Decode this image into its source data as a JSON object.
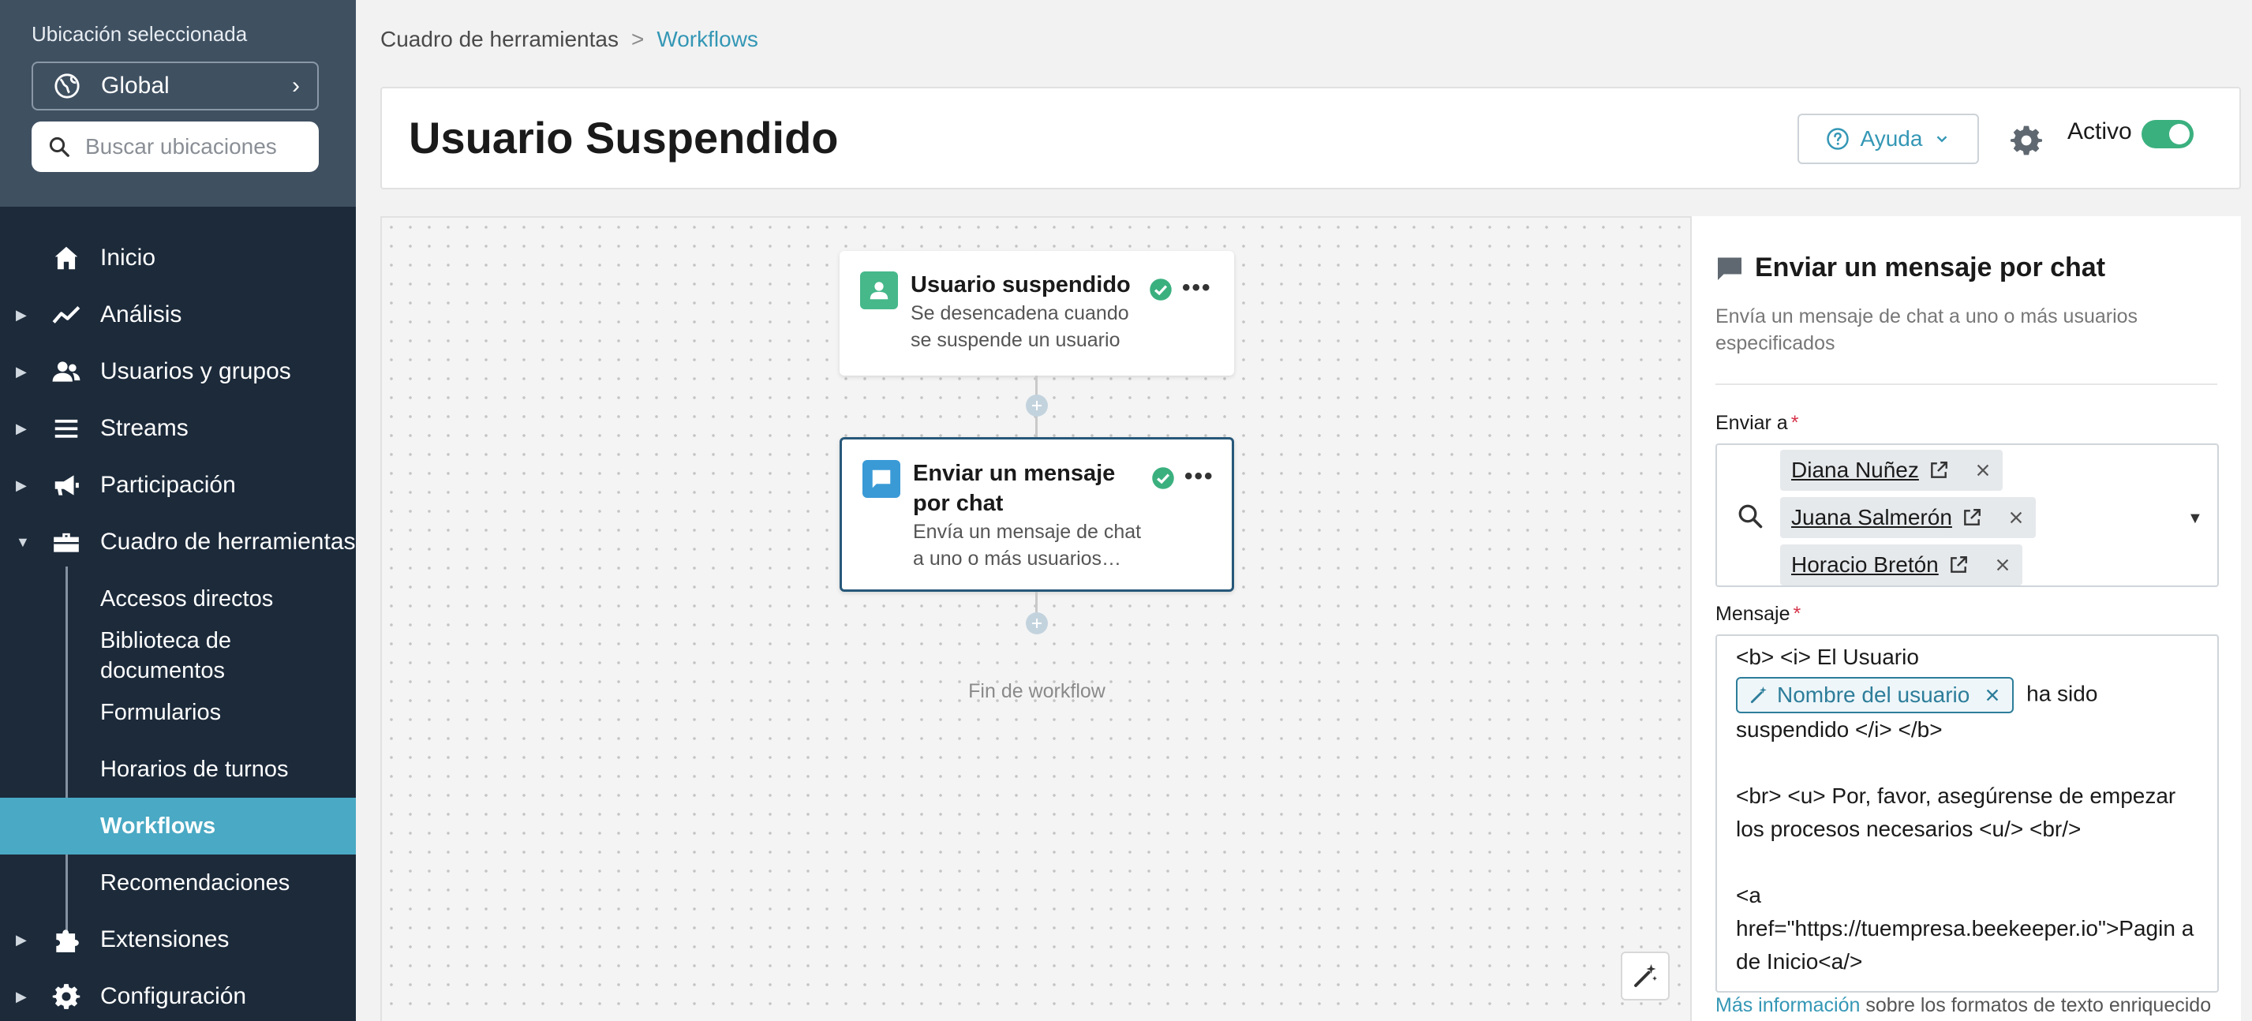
{
  "sidebar": {
    "location_label": "Ubicación seleccionada",
    "location_value": "Global",
    "search_placeholder": "Buscar ubicaciones",
    "items": [
      {
        "label": "Inicio"
      },
      {
        "label": "Análisis"
      },
      {
        "label": "Usuarios y grupos"
      },
      {
        "label": "Streams"
      },
      {
        "label": "Participación"
      },
      {
        "label": "Cuadro de herramientas"
      },
      {
        "label": "Extensiones"
      },
      {
        "label": "Configuración"
      }
    ],
    "subitems": [
      {
        "label": "Accesos directos"
      },
      {
        "label": "Biblioteca de documentos"
      },
      {
        "label": "Formularios"
      },
      {
        "label": "Horarios de turnos"
      },
      {
        "label": "Workflows"
      },
      {
        "label": "Recomendaciones"
      }
    ]
  },
  "breadcrumb": {
    "parent": "Cuadro de herramientas",
    "separator": ">",
    "current": "Workflows"
  },
  "header": {
    "title": "Usuario Suspendido",
    "help_label": "Ayuda",
    "active_label": "Activo",
    "active": true
  },
  "canvas": {
    "trigger": {
      "title": "Usuario suspendido",
      "description": "Se desencadena cuando se suspende un usuario"
    },
    "action": {
      "title": "Enviar un mensaje por chat",
      "description": "Envía un mensaje de chat a uno o más usuarios…"
    },
    "end_label": "Fin de workflow"
  },
  "panel": {
    "title": "Enviar un mensaje por chat",
    "description": "Envía un mensaje de chat a uno o más usuarios especificados",
    "send_to_label": "Enviar a",
    "recipients": [
      "Diana Nuñez",
      "Juana Salmerón",
      "Horacio Bretón"
    ],
    "message_label": "Mensaje",
    "message": {
      "line1": "<b> <i> El Usuario",
      "tag": "Nombre del usuario",
      "after_tag": "ha sido",
      "line2": "suspendido  </i>  </b>",
      "para2": "<br> <u> Por, favor, asegúrense de empezar los procesos necesarios <u/> <br/>",
      "para3a": "<a",
      "para3b": "href=\"https://tuempresa.beekeeper.io\">Pagin a de Inicio<a/>"
    },
    "info_link": "Más información",
    "info_rest": " sobre los formatos de texto enriquecido"
  },
  "colors": {
    "sidebar_bg": "#1c2a3a",
    "sidebar_top_bg": "#3f5061",
    "active_item": "#4aa9c4",
    "accent": "#3497b5",
    "toggle_on": "#3bb07f",
    "success": "#3bb07f"
  }
}
